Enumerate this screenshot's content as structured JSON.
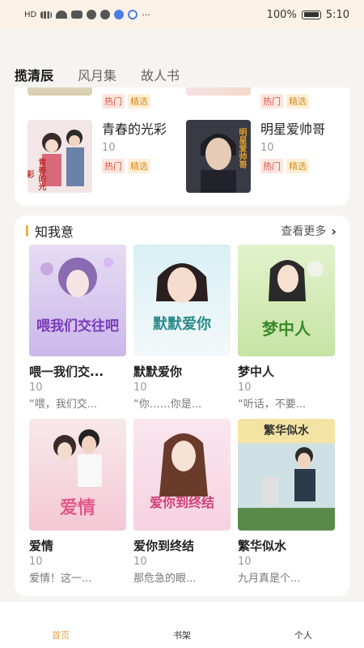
{
  "status_bar": {
    "left": "HD",
    "battery_percent": "100%",
    "time": "5:10",
    "icons": [
      "hd-signal-icon",
      "wifi-icon",
      "mail-icon",
      "app-icon",
      "app-icon",
      "app-icon",
      "app-icon",
      "more-dots-icon"
    ]
  },
  "tabs": [
    {
      "label": "揽清辰",
      "active": true
    },
    {
      "label": "风月集",
      "active": false
    },
    {
      "label": "故人书",
      "active": false
    }
  ],
  "top_books": [
    {
      "title": "",
      "count": "",
      "badges": [
        "热门",
        "精选"
      ]
    },
    {
      "title": "",
      "count": "",
      "badges": [
        "热门",
        "精选"
      ]
    },
    {
      "title": "青春的光彩",
      "count": "10",
      "badges": [
        "热门",
        "精选"
      ],
      "cover_text": "青春的光彩"
    },
    {
      "title": "明星爱帅哥",
      "count": "10",
      "badges": [
        "热门",
        "精选"
      ],
      "cover_text": "明星爱帅哥"
    }
  ],
  "section": {
    "title": "知我意",
    "more_label": "查看更多",
    "books": [
      {
        "title": "喂一我们交...",
        "count": "10",
        "desc": "“喂，我们交...",
        "cover_text": "喂我们交往吧"
      },
      {
        "title": "默默爱你",
        "count": "10",
        "desc": "“你……你是...",
        "cover_text": "默默爱你"
      },
      {
        "title": "梦中人",
        "count": "10",
        "desc": "“听话，不要...",
        "cover_text": "梦中人"
      },
      {
        "title": "爱情",
        "count": "10",
        "desc": "爱情！这一...",
        "cover_text": "爱情"
      },
      {
        "title": "爱你到终结",
        "count": "10",
        "desc": "那危急的眼...",
        "cover_text": "爱你到终结"
      },
      {
        "title": "繁华似水",
        "count": "10",
        "desc": "九月真是个...",
        "cover_text": "繁华似水"
      }
    ]
  },
  "bottom_nav": [
    {
      "label": "首页",
      "active": true
    },
    {
      "label": "书架",
      "active": false
    },
    {
      "label": "个人",
      "active": false
    }
  ],
  "colors": {
    "accent": "#f0a040",
    "badge_hot": "#e05040",
    "badge_pick": "#d98a20"
  }
}
